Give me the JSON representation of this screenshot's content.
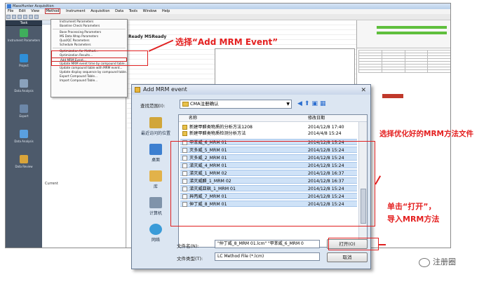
{
  "app": {
    "title": "MassHunter Acquisition",
    "menu": [
      "File",
      "Edit",
      "View",
      "Method",
      "Instrument",
      "Acquisition",
      "Data",
      "Tools",
      "Window",
      "Help"
    ],
    "active_menu": "Method"
  },
  "sidebar": {
    "header": "Task",
    "items": [
      "Instrument Parameters",
      "Project",
      "Data Analysis",
      "Export",
      "Data Analysis",
      "Data Review"
    ]
  },
  "method_menu": {
    "items": [
      "Instrument Parameters",
      "Baseline Check Parameters",
      "Base Processing Parameters",
      "MS Data Wrap Parameters",
      "Qual/QC Parameters",
      "Schedule Parameters",
      "Optimization for Method...",
      "Optimization Results...",
      "Add MRM Event...",
      "Update MRM event time by compound table...",
      "Update compound table with MRM event...",
      "Update display sequence by compound table...",
      "Export Compound Table...",
      "Import Compound Table..."
    ],
    "highlighted": "Add MRM Event..."
  },
  "main": {
    "header": "Ready MSReady",
    "left_label": "Current"
  },
  "dialog": {
    "title": "Add MRM event",
    "look_in_label": "查找范围(I):",
    "look_in_value": "CMA注册确认",
    "places": [
      "最近访问的位置",
      "桌面",
      "库",
      "计算机",
      "网络"
    ],
    "columns": {
      "name": "名称",
      "date": "修改日期"
    },
    "files": [
      {
        "name": "新建甲醛类物质的分析方法1208",
        "date": "2014/12/8 17:40",
        "type": "folder"
      },
      {
        "name": "新建甲醛类物质检测分析方法",
        "date": "2014/4/8 15:24",
        "type": "folder"
      },
      {
        "name": "甲苯威_6_MRM 01",
        "date": "2014/12/8 15:24",
        "type": "file"
      },
      {
        "name": "灭多威_5_MRM 01",
        "date": "2014/12/8 15:24",
        "type": "file"
      },
      {
        "name": "灭多威_2_MRM 01",
        "date": "2014/12/8 15:24",
        "type": "file"
      },
      {
        "name": "涕灭威_4_MRM 01",
        "date": "2014/12/8 15:24",
        "type": "file"
      },
      {
        "name": "涕灭威_1_MRM 02",
        "date": "2014/12/8 16:37",
        "type": "file"
      },
      {
        "name": "涕灭威醛_1_MRM 02",
        "date": "2014/12/8 16:37",
        "type": "file"
      },
      {
        "name": "涕灭威亚砜_1_MRM 01",
        "date": "2014/12/8 15:24",
        "type": "file"
      },
      {
        "name": "异丙威_7_MRM 01",
        "date": "2014/12/8 15:24",
        "type": "file"
      },
      {
        "name": "仲丁威_8_MRM 01",
        "date": "2014/12/8 15:24",
        "type": "file"
      }
    ],
    "filename_label": "文件名(N):",
    "filename_value": "\"仲丁威_8_MRM 01.lcm\" \"甲苯威_6_MRM 0",
    "filetype_label": "文件类型(T):",
    "filetype_value": "LC Method File (*.lcm)",
    "open_button": "打开(O)",
    "cancel_button": "取消"
  },
  "annotations": {
    "select_event": "选择“Add MRM Event”",
    "select_files": "选择优化好的MRM方法文件",
    "click_open_line1": "单击“打开”，",
    "click_open_line2": "导入MRM方法"
  },
  "watermark": "注册圈",
  "colors": {
    "annotation": "#e41f1f",
    "selection": "#2f7ad2"
  }
}
